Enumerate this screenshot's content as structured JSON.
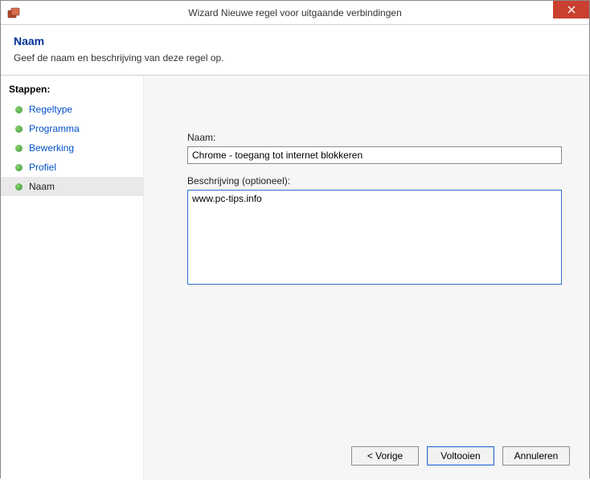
{
  "titlebar": {
    "title": "Wizard Nieuwe regel voor uitgaande verbindingen"
  },
  "header": {
    "title": "Naam",
    "description": "Geef de naam en beschrijving van deze regel op."
  },
  "sidebar": {
    "heading": "Stappen:",
    "steps": [
      {
        "label": "Regeltype",
        "current": false
      },
      {
        "label": "Programma",
        "current": false
      },
      {
        "label": "Bewerking",
        "current": false
      },
      {
        "label": "Profiel",
        "current": false
      },
      {
        "label": "Naam",
        "current": true
      }
    ]
  },
  "form": {
    "name_label": "Naam:",
    "name_value": "Chrome - toegang tot internet blokkeren",
    "desc_label": "Beschrijving (optioneel):",
    "desc_value": "www.pc-tips.info"
  },
  "buttons": {
    "back": "< Vorige",
    "finish": "Voltooien",
    "cancel": "Annuleren"
  }
}
